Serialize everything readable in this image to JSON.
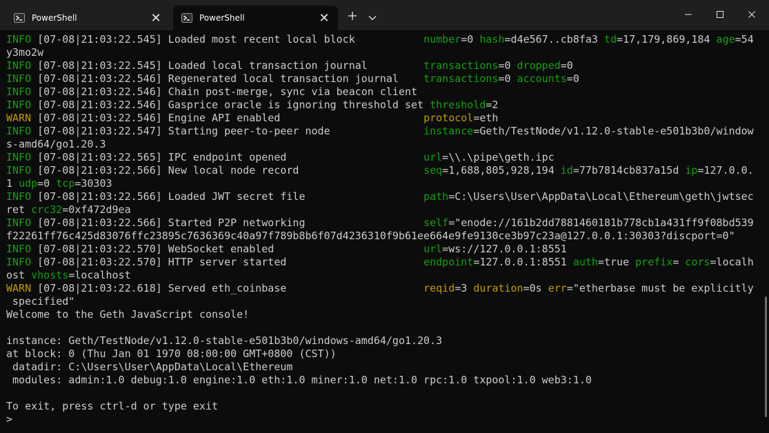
{
  "tabs": [
    {
      "label": "PowerShell",
      "active": false
    },
    {
      "label": "PowerShell",
      "active": true
    }
  ],
  "tab_actions": {
    "new_tab_icon": "plus-icon",
    "dropdown_icon": "chevron-down-icon"
  },
  "window_controls": {
    "minimize_icon": "minimize-icon",
    "maximize_icon": "maximize-icon",
    "close_icon": "close-icon"
  },
  "colors": {
    "info": "#13a10e",
    "warn": "#c19c00",
    "text": "#cccccc",
    "background": "#0c0c0c",
    "titlebar": "#1f1f1f"
  },
  "terminal_lines": [
    [
      {
        "t": "INFO",
        "c": "info"
      },
      {
        "t": " [07-08|21:03:22.545] Loaded most recent local block           "
      },
      {
        "t": "number",
        "c": "key"
      },
      {
        "t": "=0 "
      },
      {
        "t": "hash",
        "c": "key"
      },
      {
        "t": "=d4e567..cb8fa3 "
      },
      {
        "t": "td",
        "c": "key"
      },
      {
        "t": "=17,179,869,184 "
      },
      {
        "t": "age",
        "c": "key"
      },
      {
        "t": "=54"
      }
    ],
    [
      {
        "t": "y3mo2w"
      }
    ],
    [
      {
        "t": "INFO",
        "c": "info"
      },
      {
        "t": " [07-08|21:03:22.545] Loaded local transaction journal         "
      },
      {
        "t": "transactions",
        "c": "key"
      },
      {
        "t": "=0 "
      },
      {
        "t": "dropped",
        "c": "key"
      },
      {
        "t": "=0"
      }
    ],
    [
      {
        "t": "INFO",
        "c": "info"
      },
      {
        "t": " [07-08|21:03:22.546] Regenerated local transaction journal    "
      },
      {
        "t": "transactions",
        "c": "key"
      },
      {
        "t": "=0 "
      },
      {
        "t": "accounts",
        "c": "key"
      },
      {
        "t": "=0"
      }
    ],
    [
      {
        "t": "INFO",
        "c": "info"
      },
      {
        "t": " [07-08|21:03:22.546] Chain post-merge, sync via beacon client"
      }
    ],
    [
      {
        "t": "INFO",
        "c": "info"
      },
      {
        "t": " [07-08|21:03:22.546] Gasprice oracle is ignoring threshold set "
      },
      {
        "t": "threshold",
        "c": "key"
      },
      {
        "t": "=2"
      }
    ],
    [
      {
        "t": "WARN",
        "c": "warn"
      },
      {
        "t": " [07-08|21:03:22.546] Engine API enabled                       "
      },
      {
        "t": "protocol",
        "c": "wkey"
      },
      {
        "t": "=eth"
      }
    ],
    [
      {
        "t": "INFO",
        "c": "info"
      },
      {
        "t": " [07-08|21:03:22.547] Starting peer-to-peer node               "
      },
      {
        "t": "instance",
        "c": "key"
      },
      {
        "t": "=Geth/TestNode/v1.12.0-stable-e501b3b0/window"
      }
    ],
    [
      {
        "t": "s-amd64/go1.20.3"
      }
    ],
    [
      {
        "t": "INFO",
        "c": "info"
      },
      {
        "t": " [07-08|21:03:22.565] IPC endpoint opened                      "
      },
      {
        "t": "url",
        "c": "key"
      },
      {
        "t": "=\\\\.\\pipe\\geth.ipc"
      }
    ],
    [
      {
        "t": "INFO",
        "c": "info"
      },
      {
        "t": " [07-08|21:03:22.566] New local node record                    "
      },
      {
        "t": "seq",
        "c": "key"
      },
      {
        "t": "=1,688,805,928,194 "
      },
      {
        "t": "id",
        "c": "key"
      },
      {
        "t": "=77b7814cb837a15d "
      },
      {
        "t": "ip",
        "c": "key"
      },
      {
        "t": "=127.0.0."
      }
    ],
    [
      {
        "t": "1 "
      },
      {
        "t": "udp",
        "c": "key"
      },
      {
        "t": "=0 "
      },
      {
        "t": "tcp",
        "c": "key"
      },
      {
        "t": "=30303"
      }
    ],
    [
      {
        "t": "INFO",
        "c": "info"
      },
      {
        "t": " [07-08|21:03:22.566] Loaded JWT secret file                   "
      },
      {
        "t": "path",
        "c": "key"
      },
      {
        "t": "=C:\\Users\\User\\AppData\\Local\\Ethereum\\geth\\jwtsec"
      }
    ],
    [
      {
        "t": "ret "
      },
      {
        "t": "crc32",
        "c": "key"
      },
      {
        "t": "=0xf472d9ea"
      }
    ],
    [
      {
        "t": "INFO",
        "c": "info"
      },
      {
        "t": " [07-08|21:03:22.566] Started P2P networking                   "
      },
      {
        "t": "self",
        "c": "key"
      },
      {
        "t": "=\"enode://161b2dd7881460181b778cb1a431ff9f08bd539"
      }
    ],
    [
      {
        "t": "f22261ff76c425d83076ffc23895c7636369c40a97f789b8b6f07d4236310f9b61ee664e9fe9130ce3b97c23a@127.0.0.1:30303?discport=0\""
      }
    ],
    [
      {
        "t": "INFO",
        "c": "info"
      },
      {
        "t": " [07-08|21:03:22.570] WebSocket enabled                        "
      },
      {
        "t": "url",
        "c": "key"
      },
      {
        "t": "=ws://127.0.0.1:8551"
      }
    ],
    [
      {
        "t": "INFO",
        "c": "info"
      },
      {
        "t": " [07-08|21:03:22.570] HTTP server started                      "
      },
      {
        "t": "endpoint",
        "c": "key"
      },
      {
        "t": "=127.0.0.1:8551 "
      },
      {
        "t": "auth",
        "c": "key"
      },
      {
        "t": "=true "
      },
      {
        "t": "prefix",
        "c": "key"
      },
      {
        "t": "= "
      },
      {
        "t": "cors",
        "c": "key"
      },
      {
        "t": "=localh"
      }
    ],
    [
      {
        "t": "ost "
      },
      {
        "t": "vhosts",
        "c": "key"
      },
      {
        "t": "=localhost"
      }
    ],
    [
      {
        "t": "WARN",
        "c": "warn"
      },
      {
        "t": " [07-08|21:03:22.618] Served eth_coinbase                      "
      },
      {
        "t": "reqid",
        "c": "wkey"
      },
      {
        "t": "=3 "
      },
      {
        "t": "duration",
        "c": "wkey"
      },
      {
        "t": "=0s "
      },
      {
        "t": "err",
        "c": "wkey"
      },
      {
        "t": "=\"etherbase must be explicitly"
      }
    ],
    [
      {
        "t": " specified\""
      }
    ],
    [
      {
        "t": "Welcome to the Geth JavaScript console!"
      }
    ],
    [
      {
        "t": ""
      }
    ],
    [
      {
        "t": "instance: Geth/TestNode/v1.12.0-stable-e501b3b0/windows-amd64/go1.20.3"
      }
    ],
    [
      {
        "t": "at block: 0 (Thu Jan 01 1970 08:00:00 GMT+0800 (CST))"
      }
    ],
    [
      {
        "t": " datadir: C:\\Users\\User\\AppData\\Local\\Ethereum"
      }
    ],
    [
      {
        "t": " modules: admin:1.0 debug:1.0 engine:1.0 eth:1.0 miner:1.0 net:1.0 rpc:1.0 txpool:1.0 web3:1.0"
      }
    ],
    [
      {
        "t": ""
      }
    ],
    [
      {
        "t": "To exit, press ctrl-d or type exit"
      }
    ],
    [
      {
        "t": "> "
      }
    ]
  ]
}
